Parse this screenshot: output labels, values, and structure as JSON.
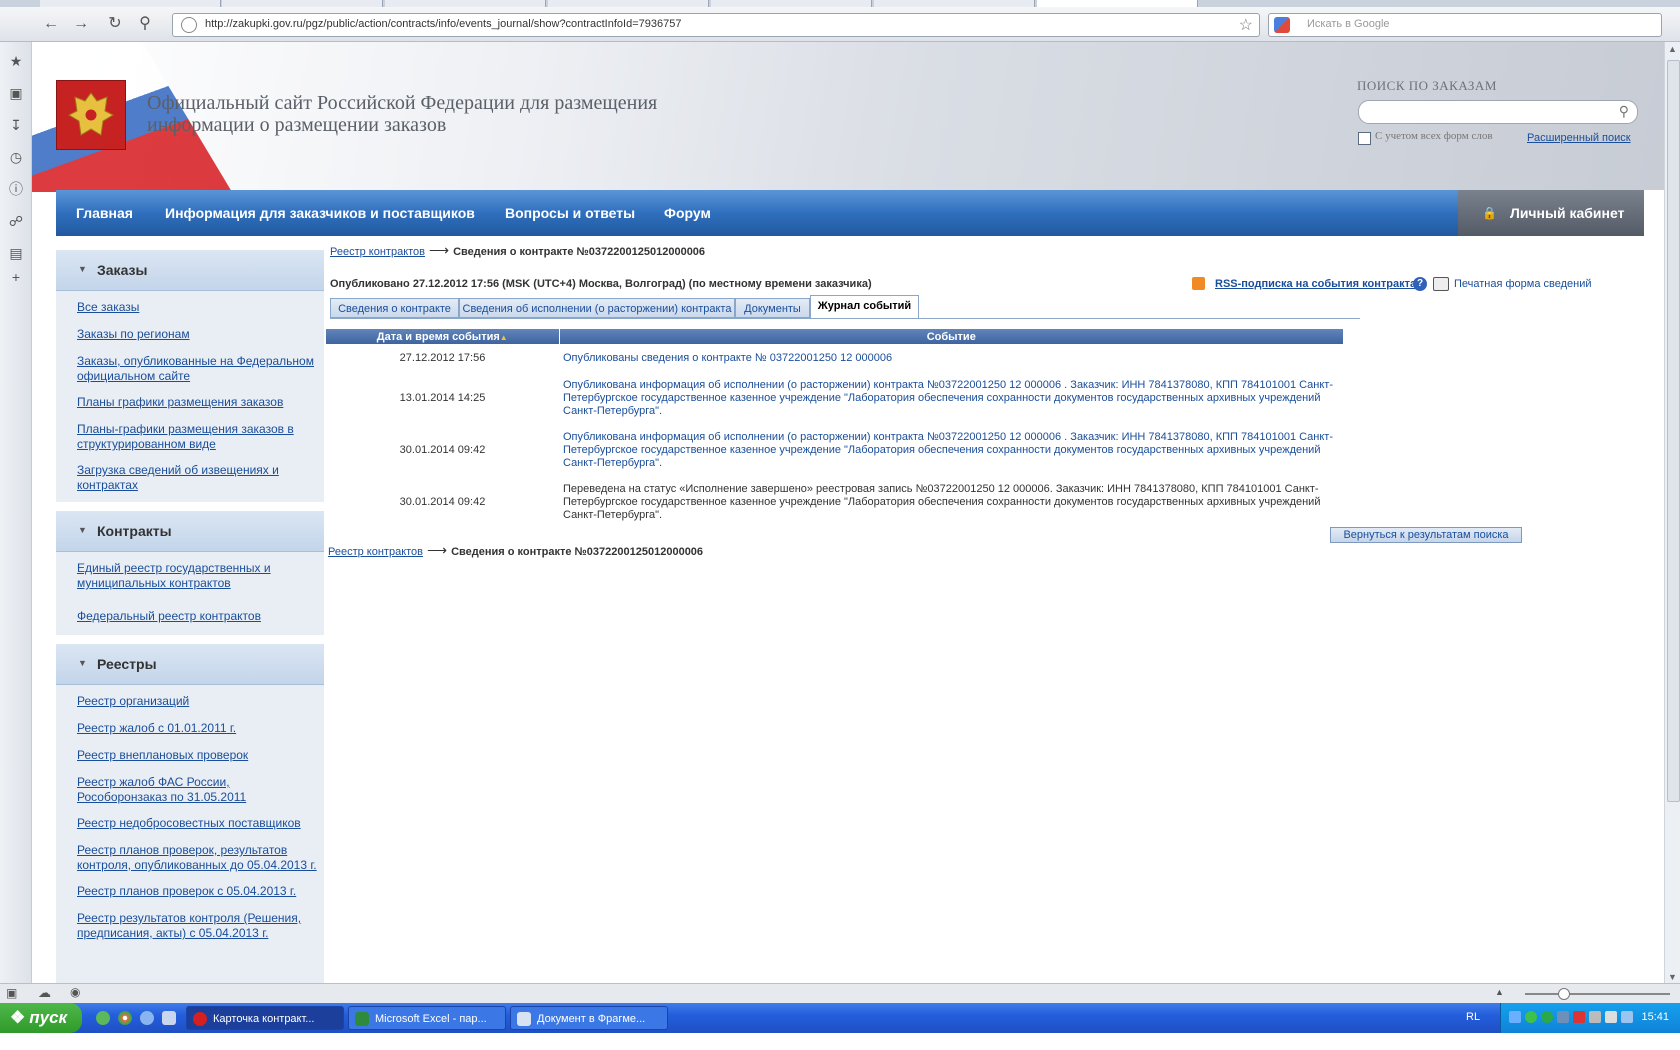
{
  "browser": {
    "url": "http://zakupki.gov.ru/pgz/public/action/contracts/info/events_journal/show?contractInfoId=7936757",
    "search_placeholder": "Искать в Google"
  },
  "site": {
    "title": "Официальный сайт Российской Федерации для размещения информации о размещении заказов",
    "search_label": "ПОИСК ПО ЗАКАЗАМ",
    "wordforms_label": "С учетом всех форм слов",
    "advanced_search": "Расширенный поиск"
  },
  "nav": {
    "items": [
      "Главная",
      "Информация для заказчиков и поставщиков",
      "Вопросы и ответы",
      "Форум"
    ],
    "cabinet": "Личный кабинет"
  },
  "sidebar": {
    "orders": {
      "title": "Заказы",
      "links": [
        "Все заказы",
        "Заказы по регионам",
        "Заказы, опубликованные на Федеральном официальном сайте",
        "Планы графики размещения заказов",
        "Планы-графики размещения заказов в структурированном виде",
        "Загрузка сведений об извещениях и контрактах"
      ]
    },
    "contracts": {
      "title": "Контракты",
      "links": [
        "Единый реестр государственных и муниципальных контрактов",
        "Федеральный реестр контрактов"
      ]
    },
    "registries": {
      "title": "Реестры",
      "links": [
        "Реестр организаций",
        "Реестр жалоб с 01.01.2011 г.",
        "Реестр внеплановых проверок",
        "Реестр жалоб ФАС России, Рособоронзаказ по 31.05.2011",
        "Реестр недобросовестных поставщиков",
        "Реестр планов проверок, результатов контроля, опубликованных до 05.04.2013 г.",
        "Реестр планов проверок с 05.04.2013 г.",
        "Реестр результатов контроля (Решения, предписания, акты) с 05.04.2013 г."
      ]
    }
  },
  "main": {
    "breadcrumb_link": "Реестр контрактов",
    "breadcrumb_current": "Сведения о контракте №0372200125012000006",
    "published": "Опубликовано 27.12.2012 17:56 (MSK (UTC+4) Москва, Волгоград) (по местному времени заказчика)",
    "rss": "RSS-подписка на события контракта",
    "print": "Печатная форма сведений",
    "tabs": [
      "Сведения о контракте",
      "Сведения об исполнении (о расторжении) контракта",
      "Документы",
      "Журнал событий"
    ],
    "table": {
      "col_date": "Дата и время события",
      "col_event": "Событие",
      "rows": [
        {
          "date": "27.12.2012 17:56",
          "event": "Опубликованы сведения о контракте № 03722001250 12 000006"
        },
        {
          "date": "13.01.2014 14:25",
          "event": "Опубликована информация об исполнении (о расторжении) контракта №03722001250 12 000006 . Заказчик: ИНН 7841378080, КПП 784101001 Санкт-Петербургское государственное казенное учреждение \"Лаборатория обеспечения сохранности документов государственных архивных учреждений Санкт-Петербурга\"."
        },
        {
          "date": "30.01.2014 09:42",
          "event": "Опубликована информация об исполнении (о расторжении) контракта №03722001250 12 000006 . Заказчик: ИНН 7841378080, КПП 784101001 Санкт-Петербургское государственное казенное учреждение \"Лаборатория обеспечения сохранности документов государственных архивных учреждений Санкт-Петербурга\"."
        },
        {
          "date": "30.01.2014 09:42",
          "event": "Переведена на статус «Исполнение завершено» реестровая запись №03722001250 12 000006. Заказчик: ИНН 7841378080, КПП 784101001 Санкт-Петербургское государственное казенное учреждение \"Лаборатория обеспечения сохранности документов государственных архивных учреждений Санкт-Петербурга\"."
        }
      ]
    },
    "back_button": "Вернуться к результатам поиска"
  },
  "taskbar": {
    "start": "пуск",
    "tasks": [
      "Карточка контракт...",
      "Microsoft Excel - пар...",
      "Документ в Фрагме..."
    ],
    "lang": "RL",
    "clock": "15:41"
  }
}
